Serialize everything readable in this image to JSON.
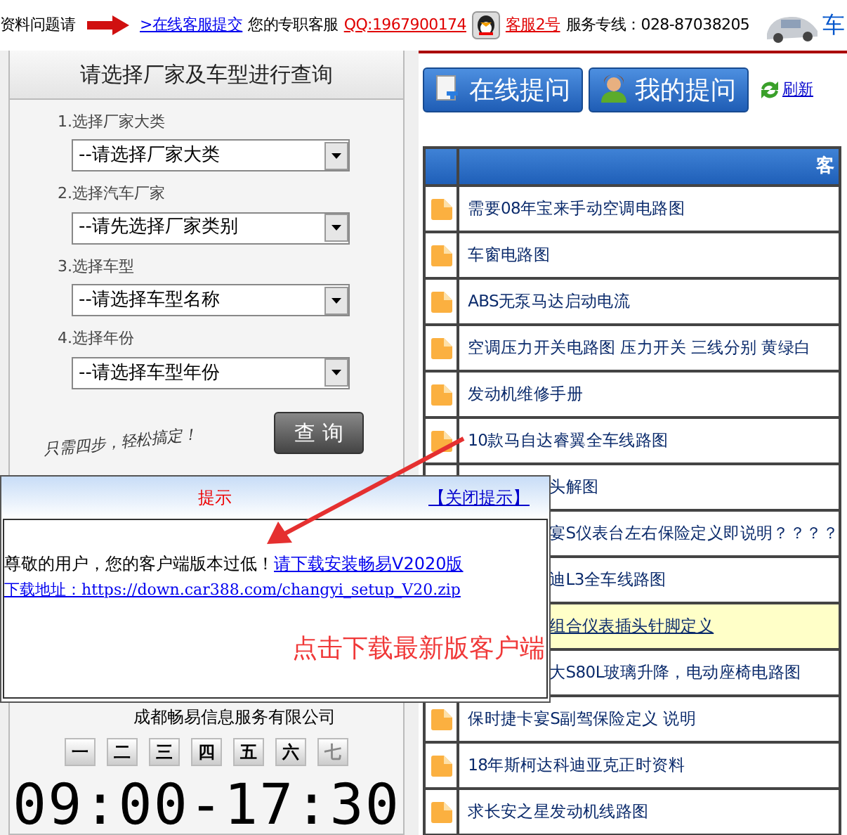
{
  "top_bar": {
    "lead_text": "资料问题请",
    "submit_link": ">在线客服提交",
    "support_label": "您的专职客服",
    "qq_link": "QQ:1967900174",
    "agent_link": "客服2号",
    "hotline": "服务专线：028-87038205",
    "cut_text": "车"
  },
  "search_panel": {
    "title": "请选择厂家及车型进行查询",
    "fields": [
      {
        "label": "1.选择厂家大类",
        "value": "--请选择厂家大类"
      },
      {
        "label": "2.选择汽车厂家",
        "value": "--请先选择厂家类别"
      },
      {
        "label": "3.选择车型",
        "value": "--请选择车型名称"
      },
      {
        "label": "4.选择年份",
        "value": "--请选择车型年份"
      }
    ],
    "slogan": "只需四步，轻松搞定！",
    "button": "查 询"
  },
  "company": "成都畅易信息服务有限公司",
  "weekdays": [
    {
      "label": "一",
      "disabled": false
    },
    {
      "label": "二",
      "disabled": false
    },
    {
      "label": "三",
      "disabled": false
    },
    {
      "label": "四",
      "disabled": false
    },
    {
      "label": "五",
      "disabled": false
    },
    {
      "label": "六",
      "disabled": false
    },
    {
      "label": "七",
      "disabled": true
    }
  ],
  "hours": "09:00-17:30",
  "toolbar": {
    "buttons": [
      "在线提问",
      "我的提问"
    ],
    "refresh": "刷新"
  },
  "table": {
    "column_2_heading": "客",
    "rows": [
      {
        "kind": "file",
        "title": "需要08年宝来手动空调电路图",
        "highlighted": false
      },
      {
        "kind": "file",
        "title": "车窗电路图",
        "highlighted": false
      },
      {
        "kind": "file",
        "title": "ABS无泵马达启动电流",
        "highlighted": false
      },
      {
        "kind": "file",
        "title": "空调压力开关电路图 压力开关 三线分别 黄绿白",
        "highlighted": false
      },
      {
        "kind": "file",
        "title": "发动机维修手册",
        "highlighted": false
      },
      {
        "kind": "file",
        "title": "10款马自达睿翼全车线路图",
        "highlighted": false
      },
      {
        "kind": "covered",
        "title": "头解图",
        "highlighted": false
      },
      {
        "kind": "covered",
        "title": "宴S仪表台左右保险定义即说明？？？？",
        "highlighted": false
      },
      {
        "kind": "covered",
        "title": "迪L3全车线路图",
        "highlighted": false
      },
      {
        "kind": "covered",
        "title": "组合仪表插头针脚定义",
        "highlighted": true
      },
      {
        "kind": "covered",
        "title": "大S80L玻璃升降，电动座椅电路图",
        "highlighted": false
      },
      {
        "kind": "file",
        "title": "保时捷卡宴S副驾保险定义 说明",
        "highlighted": false
      },
      {
        "kind": "file",
        "title": "18年斯柯达科迪亚克正时资料",
        "highlighted": false
      },
      {
        "kind": "file",
        "title": "求长安之星发动机线路图",
        "highlighted": false
      }
    ]
  },
  "popup": {
    "title": "提示",
    "close": "【关闭提示】",
    "message": "尊敬的用户，您的客户端版本过低！",
    "download_link": "请下载安装畅易V2020版",
    "address_link": "下载地址：https://down.car388.com/changyi_setup_V20.zip"
  },
  "annotation": "点击下载最新版客户端"
}
